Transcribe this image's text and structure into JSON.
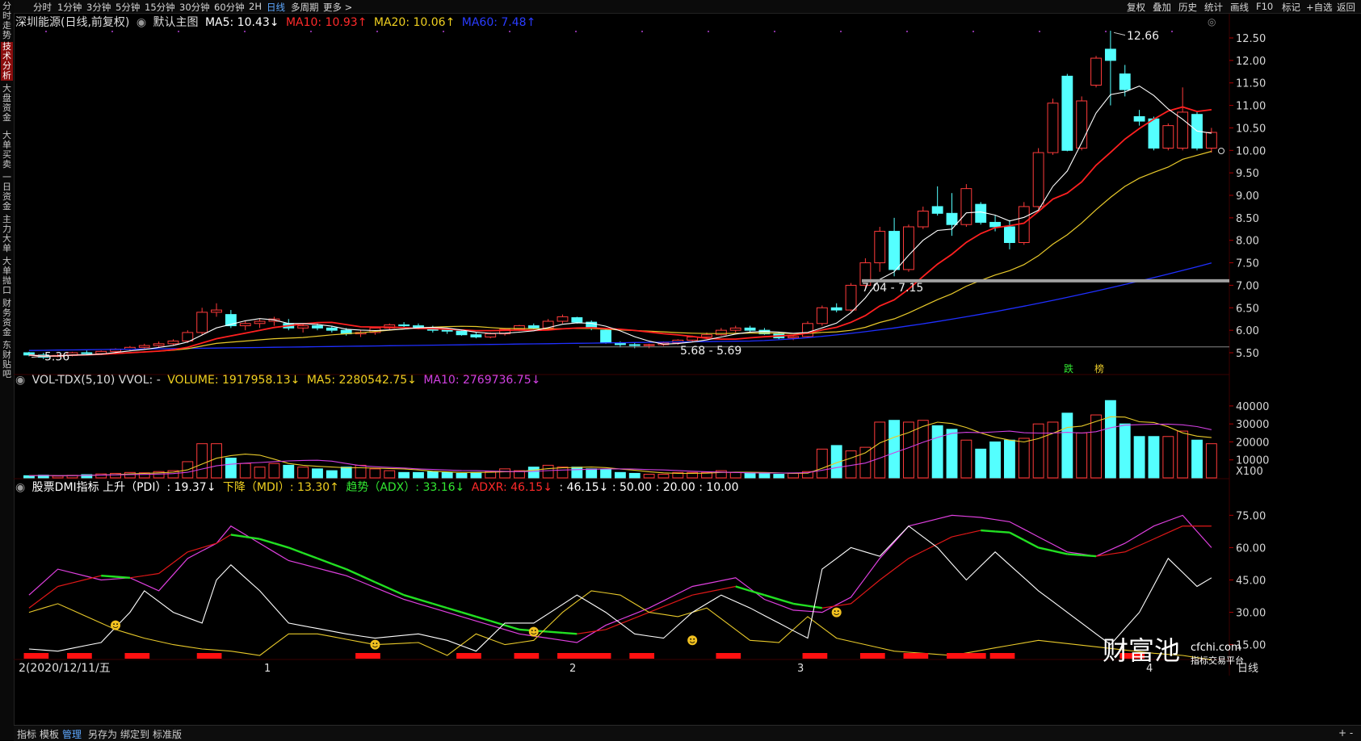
{
  "sidebar": {
    "items": [
      {
        "label": "分时走势",
        "active": false
      },
      {
        "label": "技术分析",
        "active": true
      },
      {
        "label": "大盘资金",
        "active": false
      },
      {
        "label": "大单买卖",
        "active": false
      },
      {
        "label": "一日资金",
        "active": false
      },
      {
        "label": "主力大单",
        "active": false
      },
      {
        "label": "大单抛口",
        "active": false
      },
      {
        "label": "财务资金",
        "active": false
      },
      {
        "label": "东财贴吧",
        "active": false
      }
    ]
  },
  "toolbar": {
    "periods": [
      "分时",
      "1分钟",
      "3分钟",
      "5分钟",
      "15分钟",
      "30分钟",
      "60分钟",
      "2H",
      "日线",
      "多周期",
      "更多 >"
    ],
    "active_period": "日线",
    "right": [
      "复权",
      "叠加",
      "历史",
      "统计",
      "画线",
      "F10",
      "标记",
      "+自选",
      "返回"
    ]
  },
  "main_panel": {
    "stock": "深圳能源(日线,前复权)",
    "indicator_name": "默认主图",
    "ma5": "MA5: 10.43↓",
    "ma10": "MA10: 10.93↑",
    "ma20": "MA20: 10.06↑",
    "ma60": "MA60: 7.48↑",
    "annotations": {
      "high": "12.66",
      "low_left": "5.36",
      "range_mid": "5.68 - 5.69",
      "range_right": "7.04 - 7.15",
      "signal1": "跌",
      "signal2": "榜"
    },
    "y_ticks": [
      "12.50",
      "12.00",
      "11.50",
      "11.00",
      "10.50",
      "10.00",
      "9.50",
      "9.00",
      "8.50",
      "8.00",
      "7.50",
      "7.00",
      "6.50",
      "6.00",
      "5.50"
    ]
  },
  "volume_panel": {
    "title": "VOL-TDX(5,10) VVOL: -",
    "volume": "VOLUME: 1917958.13↓",
    "ma5": "MA5: 2280542.75↓",
    "ma10": "MA10: 2769736.75↓",
    "y_ticks": [
      "40000",
      "30000",
      "20000",
      "10000",
      "X100"
    ]
  },
  "dmi_panel": {
    "title": "股票DMI指标 上升（PDI）: 19.37↓",
    "mdi": "下降（MDI）: 13.30↑",
    "adx": "趋势（ADX）: 33.16↓",
    "adxr": "ADXR: 46.15↓",
    "extra": ": 46.15↓ : 50.00 : 20.00 : 10.00",
    "y_ticks": [
      "75.00",
      "60.00",
      "45.00",
      "30.00",
      "15.00"
    ]
  },
  "x_axis": {
    "date_label": "2(2020/12/11/五",
    "months": [
      "1",
      "2",
      "3",
      "4"
    ],
    "right_label": "日线"
  },
  "watermark": {
    "text": "财富池",
    "url": "cfchi.com",
    "sub": "指标交易平台"
  },
  "bottom_tabs": [
    "指标",
    "模板",
    "管理",
    "另存为",
    "绑定到",
    "标准版"
  ],
  "bottom_active": "管理",
  "colors": {
    "up": "#ff3b3b",
    "down": "#54ffff",
    "ma5": "#ffffff",
    "ma10": "#ff2020",
    "ma20": "#e8c92a",
    "ma60": "#1f2fff",
    "pdi": "#ffffff",
    "mdi": "#e8c92a",
    "adx": "#e040e0",
    "adxr": "#ff2020"
  }
}
